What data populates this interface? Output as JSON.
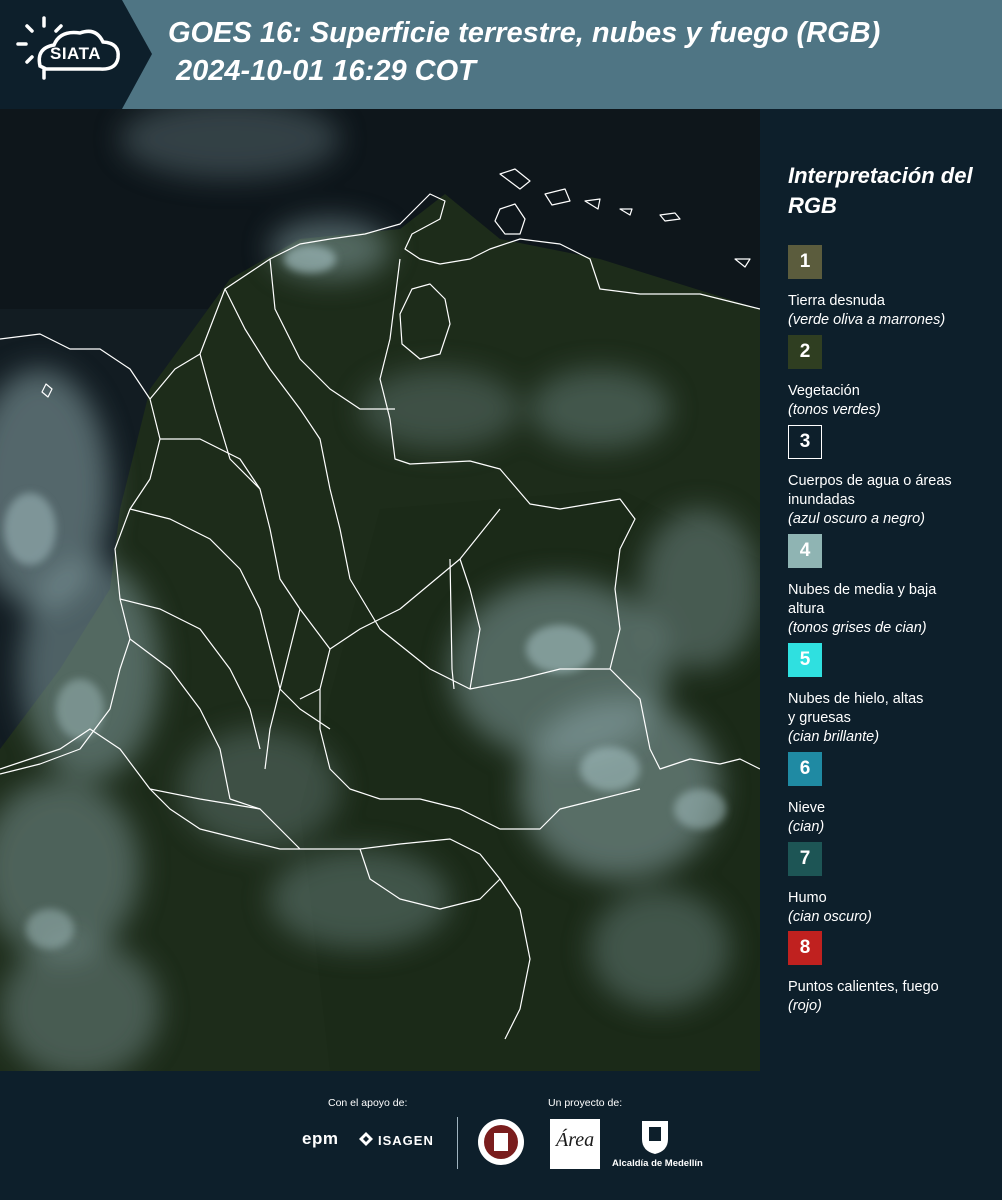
{
  "header": {
    "logo_text": "SIATA",
    "title_line1": "GOES 16: Superficie terrestre, nubes y fuego (RGB)",
    "title_line2": "2024-10-01 16:29 COT"
  },
  "legend": {
    "title": "Interpretación del RGB",
    "items": [
      {
        "number": "1",
        "label": "Tierra desnuda",
        "sub": "(verde oliva a marrones)",
        "color": "#5b5c3d"
      },
      {
        "number": "2",
        "label": "Vegetación",
        "sub": "(tonos verdes)",
        "color": "#2f3e21"
      },
      {
        "number": "3",
        "label": "Cuerpos de agua o áreas inundadas",
        "sub": "(azul oscuro a negro)",
        "color": "#0d1f2b"
      },
      {
        "number": "4",
        "label": "Nubes de media y baja altura",
        "sub": "(tonos grises de cian)",
        "color": "#8fb4b3"
      },
      {
        "number": "5",
        "label": "Nubes de hielo, altas y gruesas",
        "sub": "(cian brillante)",
        "color": "#2fe0e0"
      },
      {
        "number": "6",
        "label": "Nieve",
        "sub": "(cian)",
        "color": "#1f8aa3"
      },
      {
        "number": "7",
        "label": "Humo",
        "sub": "(cian oscuro)",
        "color": "#1d5555"
      },
      {
        "number": "8",
        "label": "Puntos calientes, fuego",
        "sub": "(rojo)",
        "color": "#c0211f"
      }
    ]
  },
  "footer": {
    "support_label": "Con el apoyo de:",
    "project_label": "Un proyecto de:",
    "sponsor_1": "epm",
    "sponsor_2": "ISAGEN",
    "partner_3": "Alcaldía de Medellín",
    "amva_text": "Área"
  },
  "colors": {
    "header_bg": "#4f7584",
    "panel_bg": "#0d1f2b",
    "land": "#1f2f1c",
    "clouds": "#8aa9ab",
    "borders": "#ffffff"
  }
}
